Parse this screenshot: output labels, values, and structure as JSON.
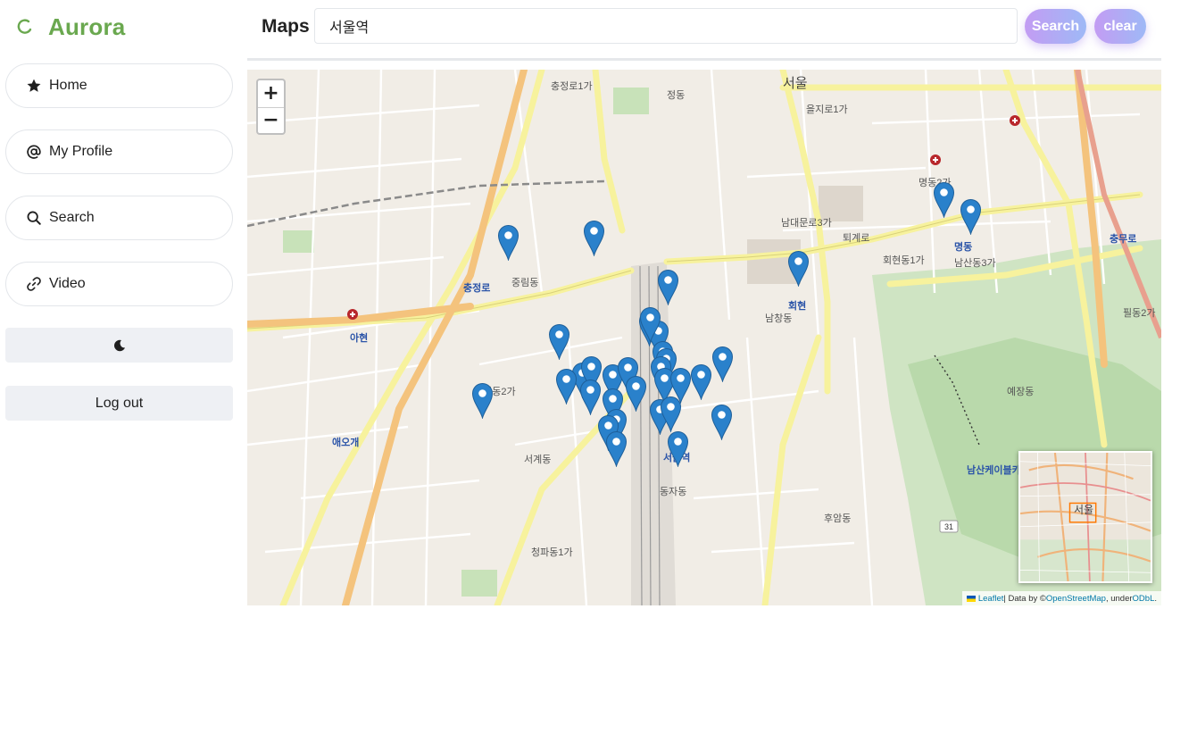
{
  "brand": {
    "name": "Aurora",
    "accent": "#6aa84f"
  },
  "sidebar": {
    "items": [
      {
        "label": "Home",
        "icon": "star-icon"
      },
      {
        "label": "My Profile",
        "icon": "at-icon"
      },
      {
        "label": "Search",
        "icon": "search-icon"
      },
      {
        "label": "Video",
        "icon": "link-icon"
      }
    ],
    "theme_toggle_icon": "moon-icon",
    "logout_label": "Log out"
  },
  "header": {
    "title": "Maps",
    "search_value": "서울역",
    "search_button": "Search",
    "clear_button": "clear",
    "button_gradient": [
      "#c39cf3",
      "#9eb9f6"
    ]
  },
  "map": {
    "zoom_in": "+",
    "zoom_out": "−",
    "attribution": {
      "leaflet": "Leaflet",
      "data_by": " | Data by © ",
      "osm": "OpenStreetMap",
      "under": ", under ",
      "odbl": "ODbL",
      "end": "."
    },
    "minimap_label": "서울",
    "labels": [
      "서울",
      "충정로1가",
      "정동",
      "을지로1가",
      "명동2가",
      "회현동1가",
      "남산동3가",
      "남대문로3가",
      "충정로",
      "서울역",
      "회현",
      "명동",
      "충무로",
      "아현",
      "애오개",
      "예장동",
      "중림동",
      "만리동2가",
      "동자동",
      "청파동1가",
      "후암동",
      "필동2가",
      "퇴계로",
      "서계동",
      "남창동",
      "남산케이블카"
    ],
    "marker_color": "#2a81cb",
    "marker_count": 33
  }
}
